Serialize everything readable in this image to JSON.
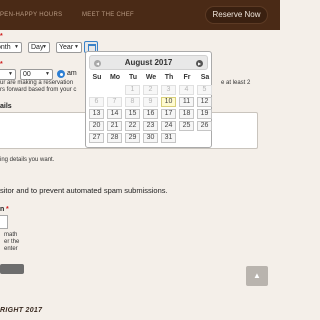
{
  "nav": {
    "happy_hours": "PEN-HAPPY HOURS",
    "meet_chef": "MEET THE CHEF",
    "reserve_label": "Reserve Now"
  },
  "date_row": {
    "required_mark": "*",
    "month_label": "onth",
    "day_label": "Day",
    "year_label": "Year"
  },
  "time_row": {
    "required_mark": "*",
    "hour_value": "r",
    "minute_value": "00",
    "ampm_selected": "am",
    "note_line1": "ur are making a reservation",
    "note_line1_end": "e at least 2",
    "note_line2": "rs forward based from your c"
  },
  "details": {
    "label": "ails",
    "helper": "ing details you want."
  },
  "spam": {
    "text": "sitor and to prevent automated spam submissions."
  },
  "captcha": {
    "label": "n",
    "required_mark": "*",
    "lines": [
      "math",
      "er the",
      "enter"
    ]
  },
  "scroll_top_icon": "up-arrow",
  "footer": {
    "copyright": "RIGHT 2017"
  },
  "datepicker": {
    "title": "August 2017",
    "prev_icon": "chevron-left",
    "next_icon": "chevron-right",
    "weekdays": [
      "Su",
      "Mo",
      "Tu",
      "We",
      "Th",
      "Fr",
      "Sa"
    ],
    "weeks": [
      [
        {
          "day": "",
          "state": "empty"
        },
        {
          "day": "",
          "state": "empty"
        },
        {
          "day": "1",
          "state": "disabled"
        },
        {
          "day": "2",
          "state": "disabled"
        },
        {
          "day": "3",
          "state": "disabled"
        },
        {
          "day": "4",
          "state": "disabled"
        },
        {
          "day": "5",
          "state": "disabled"
        }
      ],
      [
        {
          "day": "6",
          "state": "disabled"
        },
        {
          "day": "7",
          "state": "disabled"
        },
        {
          "day": "8",
          "state": "disabled"
        },
        {
          "day": "9",
          "state": "disabled"
        },
        {
          "day": "10",
          "state": "today"
        },
        {
          "day": "11",
          "state": "active"
        },
        {
          "day": "12",
          "state": "active"
        }
      ],
      [
        {
          "day": "13",
          "state": "active"
        },
        {
          "day": "14",
          "state": "active"
        },
        {
          "day": "15",
          "state": "active"
        },
        {
          "day": "16",
          "state": "active"
        },
        {
          "day": "17",
          "state": "active"
        },
        {
          "day": "18",
          "state": "active"
        },
        {
          "day": "19",
          "state": "active"
        }
      ],
      [
        {
          "day": "20",
          "state": "active"
        },
        {
          "day": "21",
          "state": "active"
        },
        {
          "day": "22",
          "state": "active"
        },
        {
          "day": "23",
          "state": "active"
        },
        {
          "day": "24",
          "state": "active"
        },
        {
          "day": "25",
          "state": "active"
        },
        {
          "day": "26",
          "state": "active"
        }
      ],
      [
        {
          "day": "27",
          "state": "active"
        },
        {
          "day": "28",
          "state": "active"
        },
        {
          "day": "29",
          "state": "active"
        },
        {
          "day": "30",
          "state": "active"
        },
        {
          "day": "31",
          "state": "active"
        },
        {
          "day": "",
          "state": "empty"
        },
        {
          "day": "",
          "state": "empty"
        }
      ]
    ]
  }
}
